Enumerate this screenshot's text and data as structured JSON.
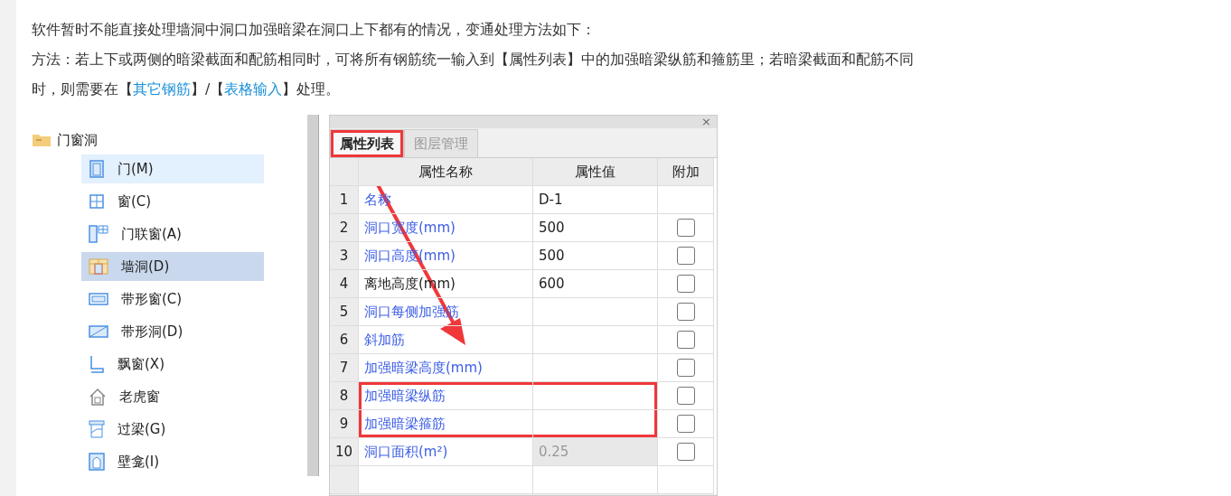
{
  "message": {
    "lines": [
      "软件暂时不能直接处理墙洞中洞口加强暗梁在洞口上下都有的情况，变通处理方法如下：",
      "方法：若上下或两侧的暗梁截面和配筋相同时，可将所有钢筋统一输入到【属性列表】中的加强暗梁纵筋和箍筋里；若暗梁截面和配筋不同",
      [
        {
          "kind": "text",
          "text": "时，则需要在【"
        },
        {
          "kind": "link",
          "text": "其它钢筋"
        },
        {
          "kind": "text",
          "text": "】/【"
        },
        {
          "kind": "link",
          "text": "表格输入"
        },
        {
          "kind": "text",
          "text": "】处理。"
        }
      ]
    ]
  },
  "tree": {
    "folder": "门窗洞",
    "items": [
      {
        "label": "门(M)",
        "selected": false,
        "hovered": true
      },
      {
        "label": "窗(C)",
        "selected": false,
        "hovered": false
      },
      {
        "label": "门联窗(A)",
        "selected": false,
        "hovered": false
      },
      {
        "label": "墙洞(D)",
        "selected": true,
        "hovered": false
      },
      {
        "label": "带形窗(C)",
        "selected": false,
        "hovered": false
      },
      {
        "label": "带形洞(D)",
        "selected": false,
        "hovered": false
      },
      {
        "label": "飘窗(X)",
        "selected": false,
        "hovered": false
      },
      {
        "label": "老虎窗",
        "selected": false,
        "hovered": false
      },
      {
        "label": "过梁(G)",
        "selected": false,
        "hovered": false
      },
      {
        "label": "壁龛(I)",
        "selected": false,
        "hovered": false
      }
    ]
  },
  "panel": {
    "close": "×",
    "tabs": [
      {
        "label": "属性列表",
        "selected": true,
        "boxed": true
      },
      {
        "label": "图层管理",
        "selected": false,
        "boxed": false
      }
    ],
    "columns": [
      "属性名称",
      "属性值",
      "附加"
    ],
    "rows": [
      {
        "index": "1",
        "name": "名称",
        "value": "D-1",
        "color": "#3b5de7",
        "kind": "plain",
        "readonly": false,
        "boxed": false
      },
      {
        "index": "2",
        "name": "洞口宽度(mm)",
        "value": "500",
        "color": "#3b5de7",
        "kind": "checkbox",
        "checked": false,
        "readonly": false,
        "boxed": false
      },
      {
        "index": "3",
        "name": "洞口高度(mm)",
        "value": "500",
        "color": "#3b5de7",
        "kind": "checkbox",
        "checked": false,
        "readonly": false,
        "boxed": false
      },
      {
        "index": "4",
        "name": "离地高度(mm)",
        "value": "600",
        "color": "#222222",
        "kind": "checkbox",
        "checked": false,
        "readonly": false,
        "boxed": false
      },
      {
        "index": "5",
        "name": "洞口每侧加强筋",
        "color": "#3b5de7",
        "kind": "checkbox",
        "checked": false,
        "readonly": false,
        "boxed": false
      },
      {
        "index": "6",
        "name": "斜加筋",
        "color": "#3b5de7",
        "kind": "checkbox",
        "checked": false,
        "readonly": false,
        "boxed": false
      },
      {
        "index": "7",
        "name": "加强暗梁高度(mm)",
        "color": "#3b5de7",
        "kind": "checkbox",
        "checked": false,
        "readonly": false,
        "boxed": false
      },
      {
        "index": "8",
        "name": "加强暗梁纵筋",
        "color": "#3b5de7",
        "kind": "checkbox",
        "checked": false,
        "readonly": false,
        "boxed": true
      },
      {
        "index": "9",
        "name": "加强暗梁箍筋",
        "color": "#3b5de7",
        "kind": "checkbox",
        "checked": false,
        "readonly": false,
        "boxed": true
      },
      {
        "index": "10",
        "name": "洞口面积(m²)",
        "value": "0.25",
        "color": "#3b5de7",
        "kind": "checkbox",
        "checked": false,
        "readonly": true,
        "boxed": false
      }
    ]
  }
}
